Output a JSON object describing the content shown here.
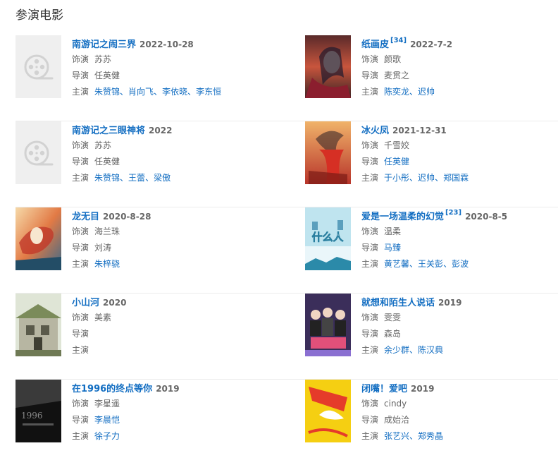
{
  "section_title": "参演电影",
  "labels": {
    "role": "饰演",
    "director": "导演",
    "cast": "主演"
  },
  "movies": [
    {
      "title": "南游记之闹三界",
      "sup": "",
      "year": "2022-10-28",
      "role": "苏苏",
      "director": [
        "任英健"
      ],
      "director_link": false,
      "cast": [
        "朱赞锦",
        "肖向飞",
        "李依晓",
        "李东恒"
      ],
      "poster": "placeholder-film-icon"
    },
    {
      "title": "纸画皮",
      "sup": "[34]",
      "year": "2022-7-2",
      "role": "颜歌",
      "director": [
        "麦贯之"
      ],
      "director_link": false,
      "cast": [
        "陈奕龙",
        "迟帅"
      ],
      "poster": "poster-paper-skin"
    },
    {
      "title": "南游记之三眼神将",
      "sup": "",
      "year": "2022",
      "role": "苏苏",
      "director": [
        "任英健"
      ],
      "director_link": false,
      "cast": [
        "朱赞锦",
        "王蕾",
        "梁傲"
      ],
      "poster": "placeholder-film-icon"
    },
    {
      "title": "冰火凤",
      "sup": "",
      "year": "2021-12-31",
      "role": "千雪姣",
      "director": [
        "任英健"
      ],
      "director_link": true,
      "cast": [
        "于小彤",
        "迟帅",
        "郑国霖"
      ],
      "poster": "poster-ice-fire-phoenix"
    },
    {
      "title": "龙无目",
      "sup": "",
      "year": "2020-8-28",
      "role": "海兰珠",
      "director": [
        "刘涛"
      ],
      "director_link": false,
      "cast": [
        "朱梓骁"
      ],
      "poster": "poster-dragon"
    },
    {
      "title": "爱是一场温柔的幻觉",
      "sup": "[23]",
      "year": "2020-8-5",
      "role": "温柔",
      "director": [
        "马臻"
      ],
      "director_link": true,
      "cast": [
        "黄艺馨",
        "王关彭",
        "彭波"
      ],
      "poster": "poster-love-illusion"
    },
    {
      "title": "小山河",
      "sup": "",
      "year": "2020",
      "role": "美素",
      "director": [],
      "director_link": false,
      "cast": [],
      "poster": "poster-little-mountain"
    },
    {
      "title": "就想和陌生人说话",
      "sup": "",
      "year": "2019",
      "role": "雯雯",
      "director": [
        "森岛"
      ],
      "director_link": false,
      "cast": [
        "余少群",
        "陈汉典"
      ],
      "poster": "poster-stranger-talk"
    },
    {
      "title": "在1996的终点等你",
      "sup": "",
      "year": "2019",
      "role": "李星遥",
      "director": [
        "李晨恺"
      ],
      "director_link": true,
      "cast": [
        "徐子力"
      ],
      "poster": "poster-1996"
    },
    {
      "title": "闭嘴！爱吧",
      "sup": "",
      "year": "2019",
      "role": "cindy",
      "director": [
        "成始洽"
      ],
      "director_link": false,
      "cast": [
        "张艺兴",
        "郑秀晶"
      ],
      "poster": "poster-shut-up-love"
    }
  ]
}
